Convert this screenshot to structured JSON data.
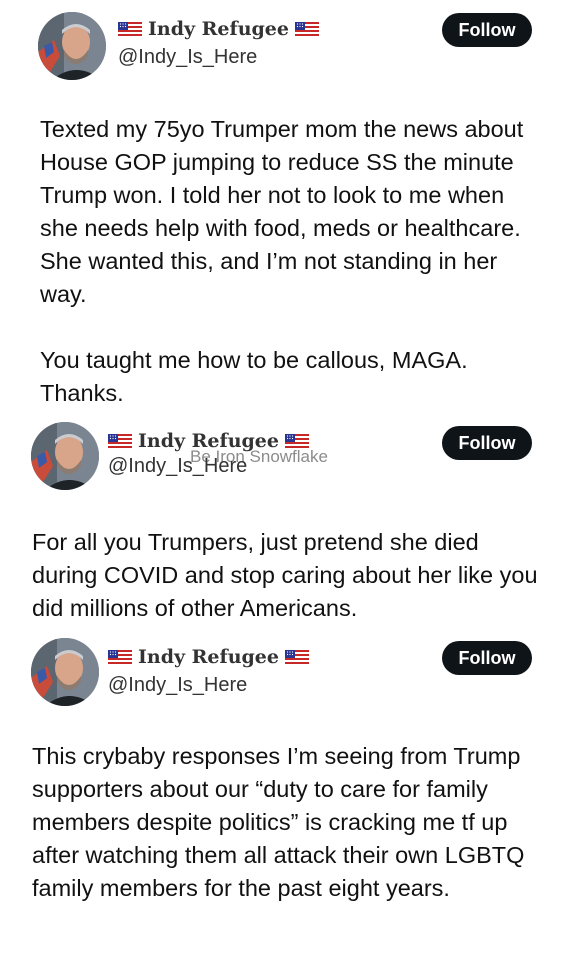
{
  "posts": [
    {
      "display_name": "Indy Refugee",
      "handle": "@Indy_Is_Here",
      "follow_label": "Follow",
      "paragraphs": [
        "Texted my 75yo Trumper mom the news about House GOP jumping to reduce SS the minute Trump won. I told her not to look to me when she needs help with food, meds or healthcare. She wanted this, and I’m not standing in her way.",
        "You taught me how to be callous, MAGA. Thanks."
      ]
    },
    {
      "display_name": "Indy Refugee",
      "handle": "@Indy_Is_Here",
      "follow_label": "Follow",
      "watermark": "Be Iron Snowflake",
      "paragraphs": [
        "For all you Trumpers, just pretend she died during COVID and stop caring about her like you did millions of other Americans."
      ]
    },
    {
      "display_name": "Indy Refugee",
      "handle": "@Indy_Is_Here",
      "follow_label": "Follow",
      "paragraphs": [
        "This crybaby responses I’m seeing from Trump supporters about our “duty to care for family members despite politics” is cracking me tf up after watching them all attack their own LGBTQ family members for the past eight years."
      ]
    }
  ],
  "icons": {
    "flag": "us-flag-icon",
    "avatar": "profile-avatar"
  },
  "colors": {
    "follow_bg": "#0f1419",
    "follow_text": "#ffffff",
    "text": "#111111"
  }
}
